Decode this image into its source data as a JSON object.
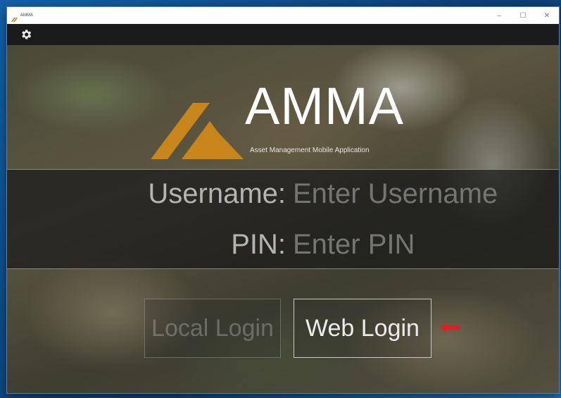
{
  "window": {
    "title": "AMMA",
    "controls": {
      "minimize": "–",
      "maximize": "☐",
      "close": "✕"
    }
  },
  "toolbar": {
    "settings_icon": "gear-icon"
  },
  "brand": {
    "name": "AMMA",
    "tagline": "Asset Management Mobile Application",
    "logo_color": "#c8861a"
  },
  "form": {
    "username_label": "Username:",
    "username_placeholder": "Enter Username",
    "username_value": "",
    "pin_label": "PIN:",
    "pin_placeholder": "Enter PIN",
    "pin_value": ""
  },
  "buttons": {
    "local_login": "Local Login",
    "web_login": "Web Login"
  },
  "annotation": {
    "arrow_color": "#e02020",
    "arrow_icon": "left-arrow-icon"
  }
}
